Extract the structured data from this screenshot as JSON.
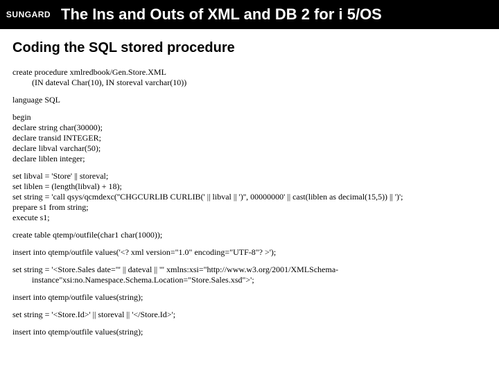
{
  "header": {
    "logo": "SUNGARD",
    "title": "The Ins and Outs of XML and DB 2 for i 5/OS"
  },
  "subtitle": "Coding the SQL stored procedure",
  "code": {
    "l01": "create procedure xmlredbook/Gen.Store.XML",
    "l02": "(IN dateval Char(10), IN storeval varchar(10))",
    "l03": "language SQL",
    "l04": "begin",
    "l05": "declare string char(30000);",
    "l06": "declare transid INTEGER;",
    "l07": "declare libval varchar(50);",
    "l08": "declare liblen integer;",
    "l09": "set libval = 'Store' || storeval;",
    "l10": "set liblen = (length(libval) + 18);",
    "l11": "set string = 'call qsys/qcmdexc(''CHGCURLIB CURLIB(' || libval || ')'', 00000000' || cast(liblen as decimal(15,5)) || ')';",
    "l12": "prepare s1 from string;",
    "l13": "execute s1;",
    "l14": "create table qtemp/outfile(char1 char(1000));",
    "l15": "insert into qtemp/outfile values('<? xml version=\"1.0\" encoding=\"UTF-8\"? >');",
    "l16": "set string = '<Store.Sales date=\"' || dateval || '\" xmlns:xsi=\"http://www.w3.org/2001/XMLSchema-",
    "l17": "instance\"xsi:no.Namespace.Schema.Location=\"Store.Sales.xsd\">';",
    "l18": "insert into qtemp/outfile values(string);",
    "l19": "set string = '<Store.Id>' || storeval || '</Store.Id>';",
    "l20": "insert into qtemp/outfile values(string);"
  }
}
